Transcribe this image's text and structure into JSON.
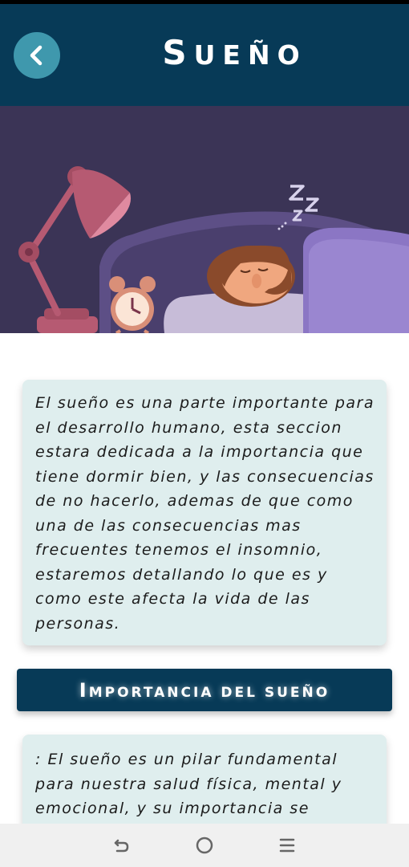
{
  "header": {
    "title_initial": "S",
    "title_rest": "UEÑO",
    "back_icon": "chevron-left-icon",
    "background_color": "#073a57",
    "back_button_color": "#3f98ad"
  },
  "hero": {
    "image": "sleeping-man-illustration",
    "snore_text": "ZzZ"
  },
  "intro": {
    "text": "El sueño es una parte importante para el desarrollo humano, esta seccion estara dedicada a la importancia que tiene dormir bien, y las consecuencias de no hacerlo, ademas de que como una de las consecuencias mas frecuentes tenemos el insomnio, estaremos detallando lo que es y como este afecta la vida de las personas."
  },
  "section": {
    "title_initial": "I",
    "title_rest": "MPORTANCIA DEL SUEÑO"
  },
  "second_card": {
    "text": ": El sueño es un pilar fundamental para nuestra salud física, mental y emocional, y su importancia se"
  },
  "nav": {
    "back_icon": "back-gesture-icon",
    "home_icon": "home-circle-icon",
    "recents_icon": "recents-menu-icon"
  },
  "colors": {
    "card_background": "#dfeeee",
    "accent": "#073a57"
  }
}
